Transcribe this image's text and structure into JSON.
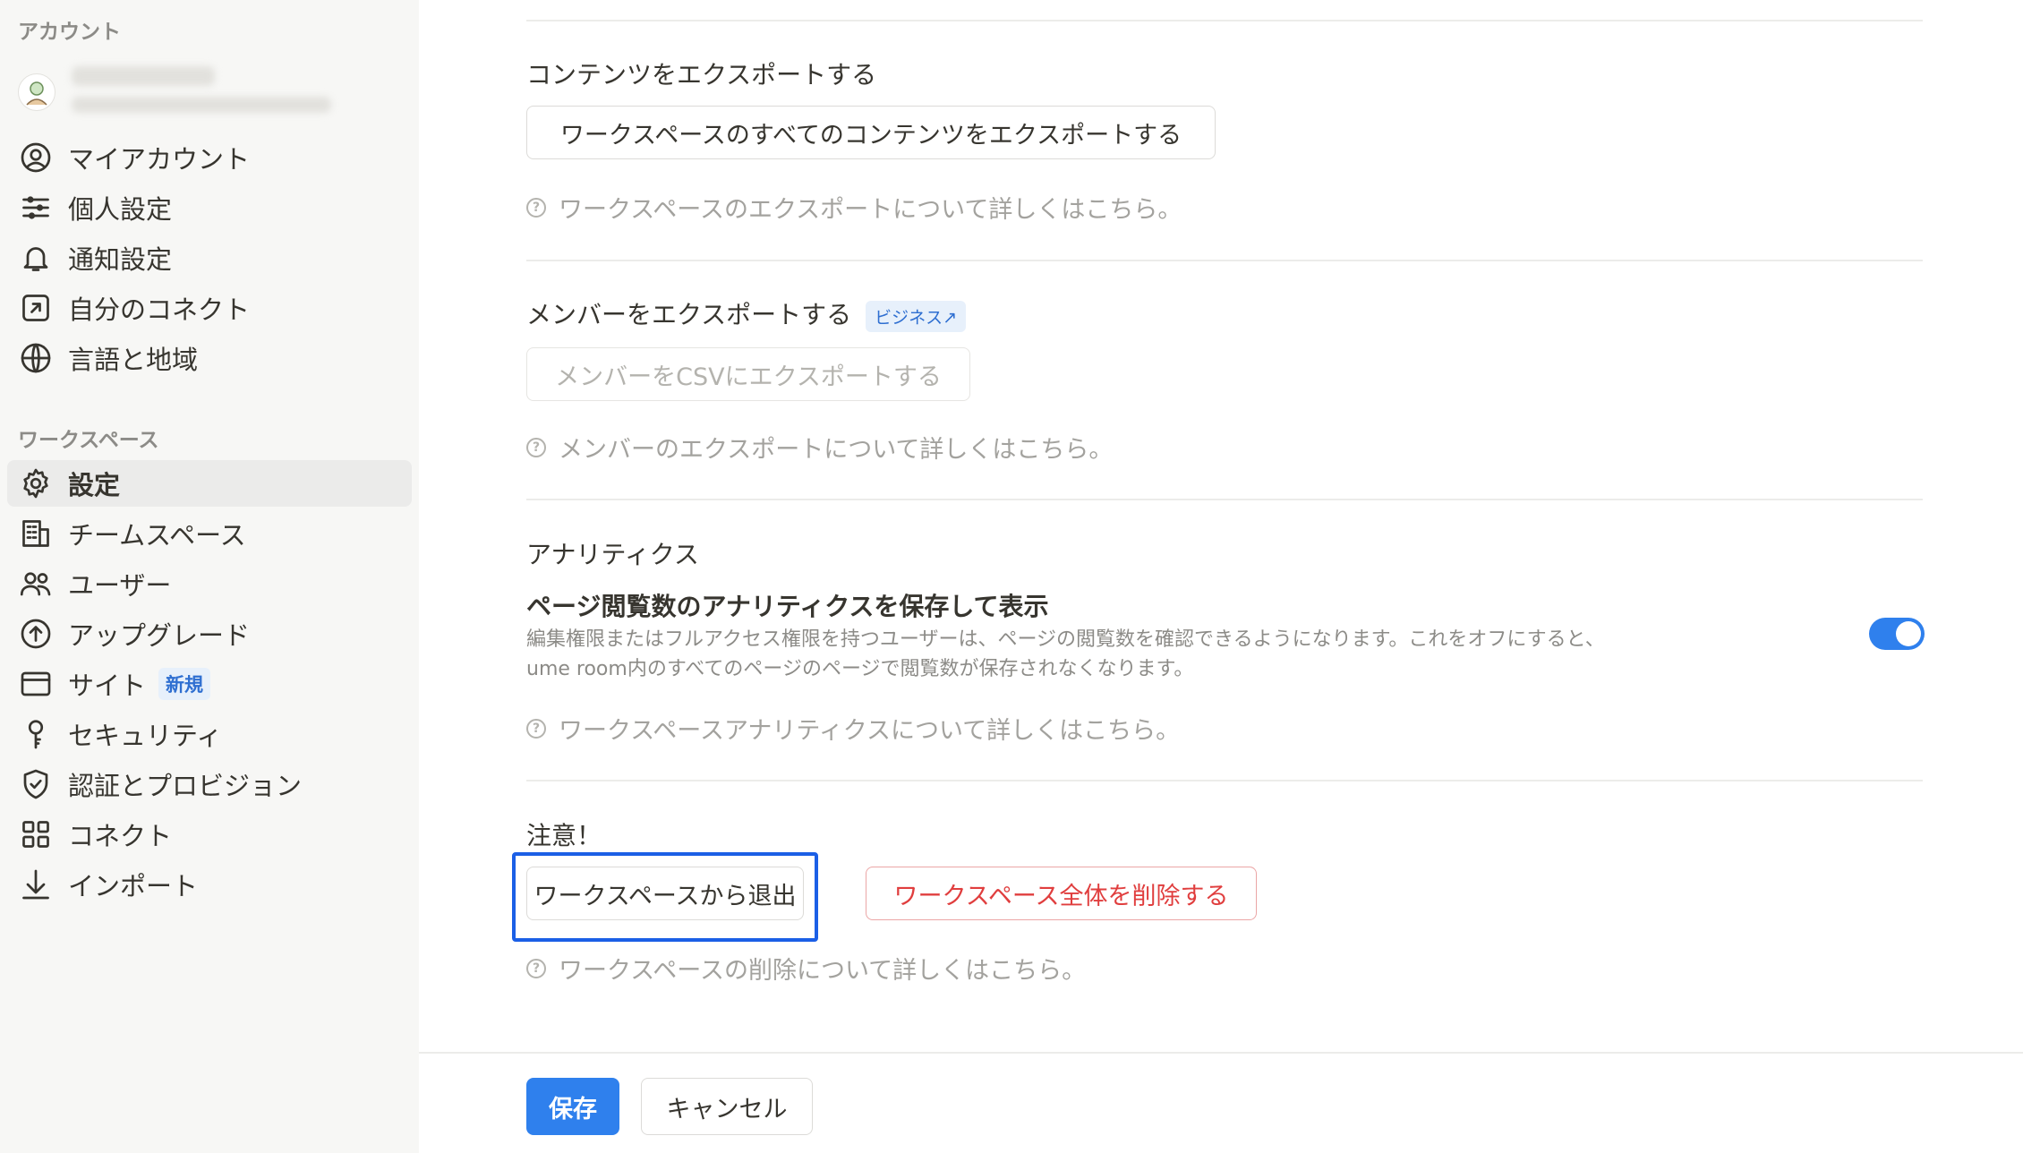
{
  "sidebar": {
    "account_label": "アカウント",
    "account_items": [
      {
        "label": "マイアカウント",
        "icon": "user-circle-icon"
      },
      {
        "label": "個人設定",
        "icon": "sliders-icon"
      },
      {
        "label": "通知設定",
        "icon": "bell-icon"
      },
      {
        "label": "自分のコネクト",
        "icon": "arrow-square-icon"
      },
      {
        "label": "言語と地域",
        "icon": "globe-icon"
      }
    ],
    "workspace_label": "ワークスペース",
    "workspace_items": [
      {
        "label": "設定",
        "icon": "gear-icon",
        "active": true
      },
      {
        "label": "チームスペース",
        "icon": "building-icon"
      },
      {
        "label": "ユーザー",
        "icon": "users-icon"
      },
      {
        "label": "アップグレード",
        "icon": "arrow-up-circle-icon"
      },
      {
        "label": "サイト",
        "icon": "browser-icon",
        "badge": "新規"
      },
      {
        "label": "セキュリティ",
        "icon": "key-icon"
      },
      {
        "label": "認証とプロビジョン",
        "icon": "shield-check-icon"
      },
      {
        "label": "コネクト",
        "icon": "grid-icon"
      },
      {
        "label": "インポート",
        "icon": "download-icon"
      }
    ]
  },
  "export_content": {
    "title": "コンテンツをエクスポートする",
    "button": "ワークスペースのすべてのコンテンツをエクスポートする",
    "help": "ワークスペースのエクスポートについて詳しくはこちら。"
  },
  "export_members": {
    "title": "メンバーをエクスポートする",
    "badge": "ビジネス↗",
    "button": "メンバーをCSVにエクスポートする",
    "help": "メンバーのエクスポートについて詳しくはこちら。"
  },
  "analytics": {
    "title": "アナリティクス",
    "setting_title": "ページ閲覧数のアナリティクスを保存して表示",
    "description_line1": "編集権限またはフルアクセス権限を持つユーザーは、ページの閲覧数を確認できるようになります。これをオフにすると、",
    "description_line2": "ume room内のすべてのページのページで閲覧数が保存されなくなります。",
    "toggle_on": true,
    "help": "ワークスペースアナリティクスについて詳しくはこちら。"
  },
  "danger": {
    "title": "注意！",
    "leave_button": "ワークスペースから退出",
    "delete_button": "ワークスペース全体を削除する",
    "help": "ワークスペースの削除について詳しくはこちら。"
  },
  "footer": {
    "save": "保存",
    "cancel": "キャンセル"
  },
  "colors": {
    "accent": "#2f80ed",
    "danger": "#e03e3e",
    "highlight": "#1b5fe6"
  }
}
